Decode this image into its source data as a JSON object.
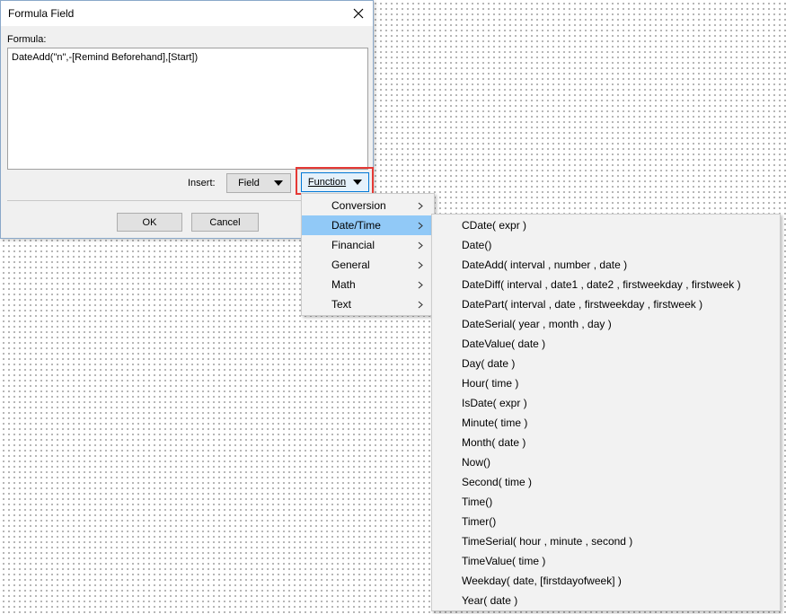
{
  "dialog": {
    "title": "Formula Field",
    "formula_label": "Formula:",
    "formula_value": "DateAdd(\"n\",-[Remind Beforehand],[Start])",
    "insert_label": "Insert:",
    "field_button": "Field",
    "function_button": "Function",
    "ok_button": "OK",
    "cancel_button": "Cancel"
  },
  "function_menu": {
    "items": [
      {
        "label": "Conversion"
      },
      {
        "label": "Date/Time"
      },
      {
        "label": "Financial"
      },
      {
        "label": "General"
      },
      {
        "label": "Math"
      },
      {
        "label": "Text"
      }
    ],
    "selected_index": 1
  },
  "datetime_menu": {
    "items": [
      "CDate( expr )",
      "Date()",
      "DateAdd( interval , number , date )",
      "DateDiff( interval , date1 , date2 , firstweekday , firstweek )",
      "DatePart( interval , date , firstweekday , firstweek )",
      "DateSerial( year , month , day )",
      "DateValue( date )",
      "Day( date )",
      "Hour( time )",
      "IsDate( expr )",
      "Minute( time )",
      "Month( date )",
      "Now()",
      "Second( time )",
      "Time()",
      "Timer()",
      "TimeSerial( hour , minute , second )",
      "TimeValue( time )",
      "Weekday( date, [firstdayofweek] )",
      "Year( date )"
    ]
  },
  "colors": {
    "highlight_border": "#e53935",
    "menu_selected": "#91c9f7",
    "focus_border": "#0078d7"
  },
  "icons": {
    "close": "close-icon",
    "dropdown": "caret-down-icon",
    "submenu": "chevron-right-icon"
  }
}
